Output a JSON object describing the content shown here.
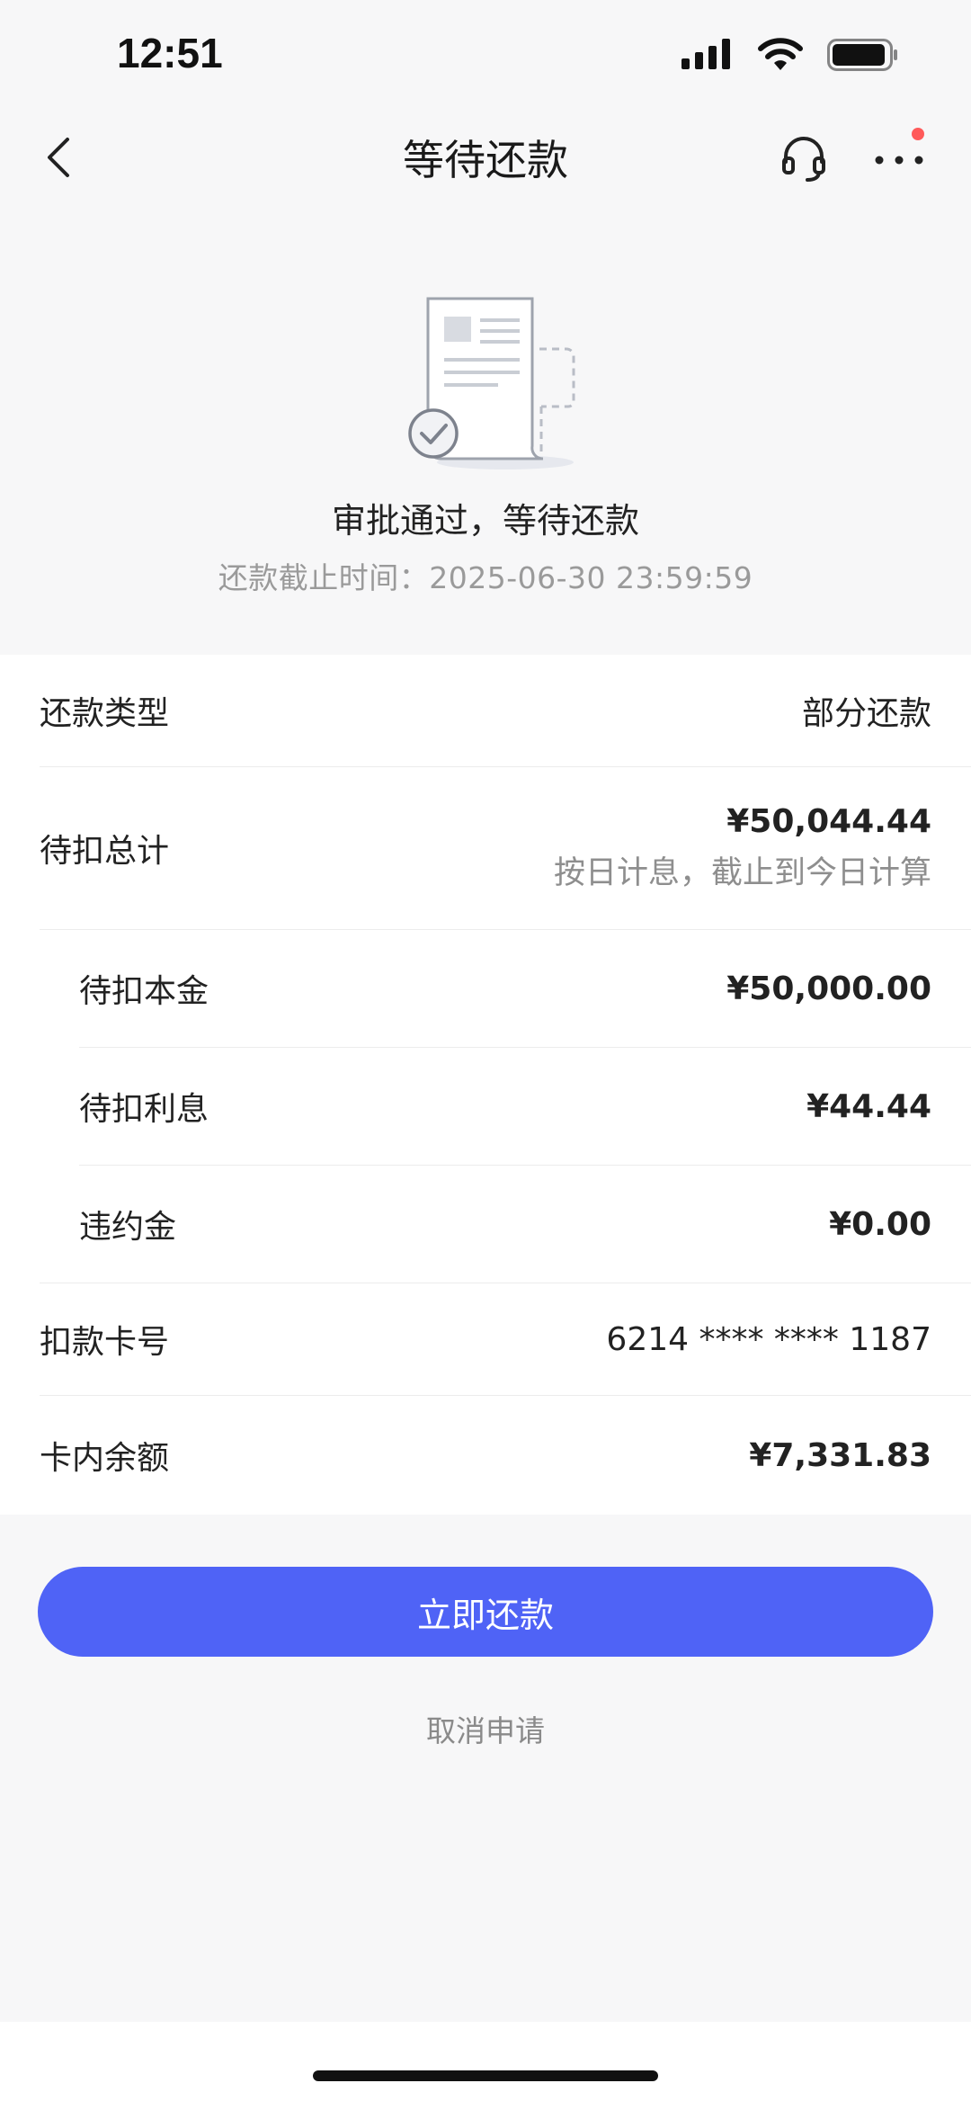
{
  "status_bar": {
    "time": "12:51"
  },
  "nav": {
    "title": "等待还款"
  },
  "hero": {
    "title": "审批通过，等待还款",
    "deadline": "还款截止时间：2025-06-30 23:59:59"
  },
  "details": {
    "repay_type": {
      "label": "还款类型",
      "value": "部分还款"
    },
    "total": {
      "label": "待扣总计",
      "value": "¥50,044.44",
      "note": "按日计息，截止到今日计算"
    },
    "principal": {
      "label": "待扣本金",
      "value": "¥50,000.00"
    },
    "interest": {
      "label": "待扣利息",
      "value": "¥44.44"
    },
    "penalty": {
      "label": "违约金",
      "value": "¥0.00"
    },
    "card_no": {
      "label": "扣款卡号",
      "value": "6214 **** **** 1187"
    },
    "balance": {
      "label": "卡内余额",
      "value": "¥7,331.83"
    }
  },
  "actions": {
    "pay_label": "立即还款",
    "cancel_label": "取消申请"
  },
  "colors": {
    "primary": "#4f63f6",
    "badge": "#ff5a5a"
  },
  "icons": [
    "back-icon",
    "headset-icon",
    "more-icon",
    "cellular-signal-icon",
    "wifi-icon",
    "battery-icon",
    "document-check-illustration"
  ]
}
